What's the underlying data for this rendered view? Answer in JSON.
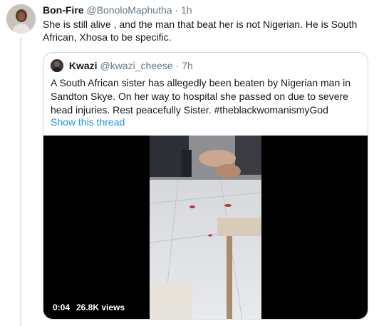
{
  "tweet": {
    "name": "Bon-Fire",
    "handle": "@BonoloMaphutha",
    "separator": "·",
    "time": "1h",
    "text": "She is still alive , and the man that beat her is not Nigerian. He is South African, Xhosa to be specific."
  },
  "quote": {
    "name": "Kwazi",
    "handle": "@kwazi_cheese",
    "separator": "·",
    "time": "7h",
    "text": "A South African sister has allegedly been beaten by Nigerian man in Sandton Skye. On her way to hospital she passed on due to severe head injuries. Rest peacefully Sister. #theblackwomanismyGod",
    "show_thread": "Show this thread"
  },
  "video": {
    "duration": "0:04",
    "views": "26.8K views"
  },
  "colors": {
    "link": "#1b95e0",
    "meta": "#657786",
    "border": "#ccd6dd"
  }
}
